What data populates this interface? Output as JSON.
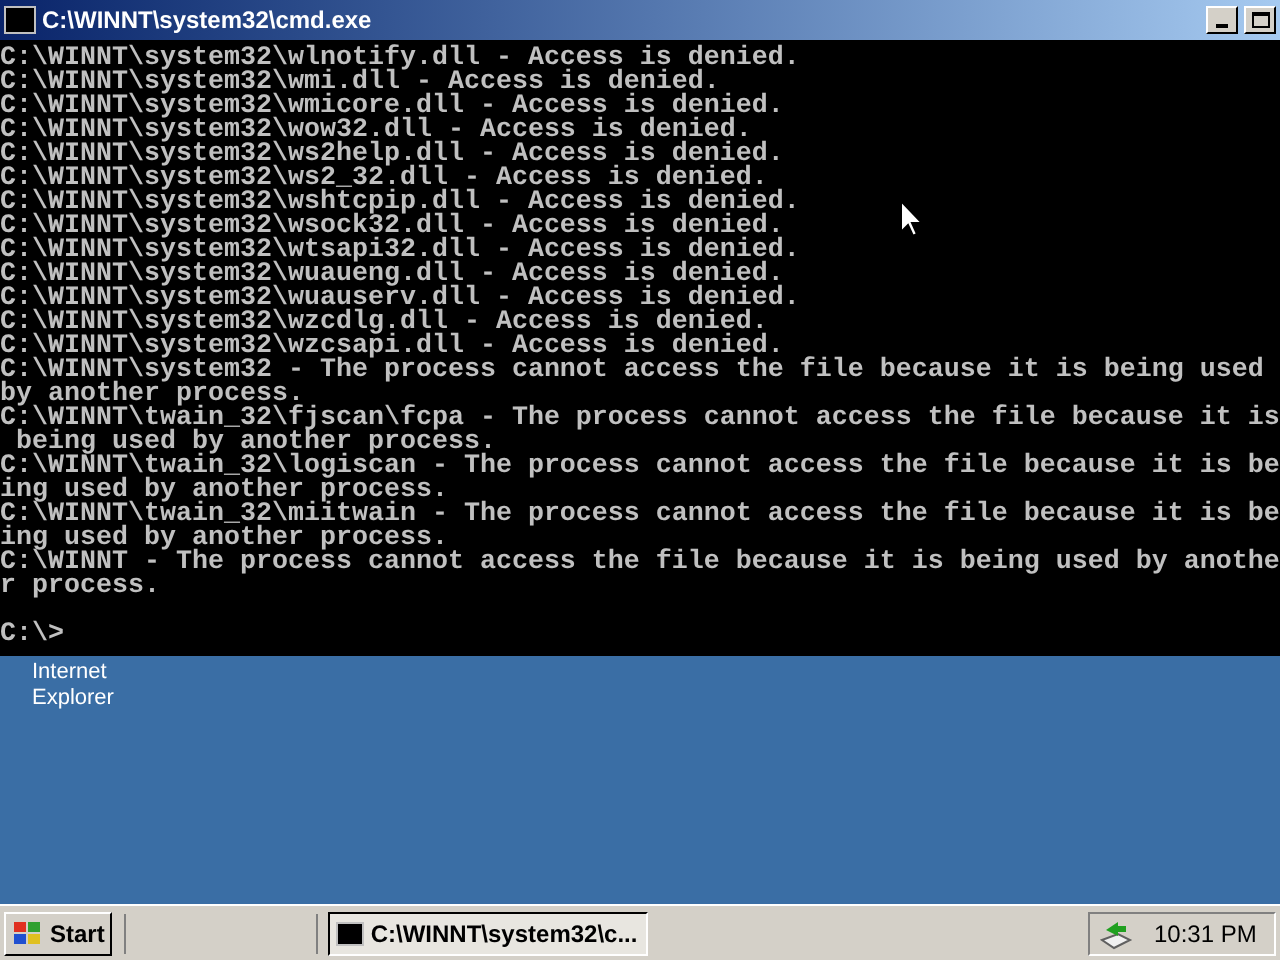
{
  "window": {
    "title": "C:\\WINNT\\system32\\cmd.exe"
  },
  "console": {
    "lines": [
      "C:\\WINNT\\system32\\wlnotify.dll - Access is denied.",
      "C:\\WINNT\\system32\\wmi.dll - Access is denied.",
      "C:\\WINNT\\system32\\wmicore.dll - Access is denied.",
      "C:\\WINNT\\system32\\wow32.dll - Access is denied.",
      "C:\\WINNT\\system32\\ws2help.dll - Access is denied.",
      "C:\\WINNT\\system32\\ws2_32.dll - Access is denied.",
      "C:\\WINNT\\system32\\wshtcpip.dll - Access is denied.",
      "C:\\WINNT\\system32\\wsock32.dll - Access is denied.",
      "C:\\WINNT\\system32\\wtsapi32.dll - Access is denied.",
      "C:\\WINNT\\system32\\wuaueng.dll - Access is denied.",
      "C:\\WINNT\\system32\\wuauserv.dll - Access is denied.",
      "C:\\WINNT\\system32\\wzcdlg.dll - Access is denied.",
      "C:\\WINNT\\system32\\wzcsapi.dll - Access is denied.",
      "C:\\WINNT\\system32 - The process cannot access the file because it is being used",
      "by another process.",
      "C:\\WINNT\\twain_32\\fjscan\\fcpa - The process cannot access the file because it is",
      " being used by another process.",
      "C:\\WINNT\\twain_32\\logiscan - The process cannot access the file because it is be",
      "ing used by another process.",
      "C:\\WINNT\\twain_32\\miitwain - The process cannot access the file because it is be",
      "ing used by another process.",
      "C:\\WINNT - The process cannot access the file because it is being used by anothe",
      "r process."
    ],
    "prompt": "C:\\>"
  },
  "desktop": {
    "icons": [
      {
        "label": "Internet\nExplorer"
      }
    ]
  },
  "taskbar": {
    "start": "Start",
    "tasks": [
      {
        "label": "C:\\WINNT\\system32\\c...",
        "selected": true
      }
    ],
    "clock": "10:31 PM"
  }
}
